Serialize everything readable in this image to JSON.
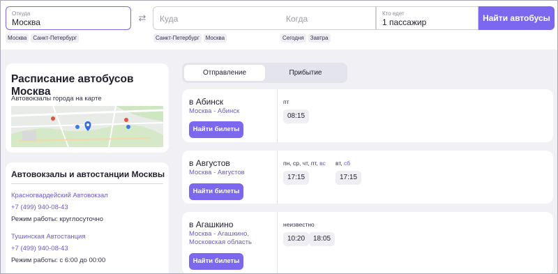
{
  "search": {
    "from_label": "Откуда",
    "from_value": "Москва",
    "to_placeholder": "Куда",
    "when_placeholder": "Когда",
    "who_label": "Кто едет",
    "who_value": "1 пассажир",
    "find_button": "Найти автобусы",
    "from_chips": [
      "Москва",
      "Санкт-Петербург"
    ],
    "to_chips": [
      "Санкт-Петербург",
      "Москва"
    ],
    "when_chips": [
      "Сегодня",
      "Завтра"
    ]
  },
  "schedule": {
    "title": "Расписание автобусов Москва",
    "map_label": "Автовокзалы города на карте"
  },
  "stations": {
    "title": "Автовокзалы и автостанции Москвы",
    "items": [
      {
        "name": "Красногвардейский Автовокзал",
        "phone": "+7 (499) 940-08-43",
        "hours": "Режим работы: круглосуточно"
      },
      {
        "name": "Тушинская Автостанция",
        "phone": "+7 (499) 940-08-43",
        "hours": "Режим работы: с 6:00 до 00:00"
      }
    ]
  },
  "tabs": {
    "departure": "Отправление",
    "arrival": "Прибытие"
  },
  "trips": [
    {
      "city": "в Абинск",
      "route": "Москва - Абинск",
      "button": "Найти билеты",
      "groups": [
        {
          "days": [
            {
              "t": "пт",
              "hl": false
            }
          ],
          "times": [
            "08:15"
          ]
        }
      ]
    },
    {
      "city": "в Августов",
      "route": "Москва - Августов",
      "button": "Найти билеты",
      "groups": [
        {
          "days": [
            {
              "t": "пн, ср, чт, пт, ",
              "hl": false
            },
            {
              "t": "вс",
              "hl": true
            }
          ],
          "times": [
            "17:15"
          ]
        },
        {
          "days": [
            {
              "t": "вт, ",
              "hl": false
            },
            {
              "t": "сб",
              "hl": true
            }
          ],
          "times": [
            "17:15"
          ]
        }
      ]
    },
    {
      "city": "в Агашкино",
      "route": "Москва - Агашкино, Московская область",
      "button": "Найти билеты",
      "groups": [
        {
          "days": [
            {
              "t": "неизвестно",
              "hl": false
            }
          ],
          "times": [
            "10:20",
            "18:05"
          ]
        }
      ]
    }
  ],
  "colors": {
    "accent": "#7b68ee",
    "link": "#6a5acd",
    "background": "#f1f1f5"
  }
}
